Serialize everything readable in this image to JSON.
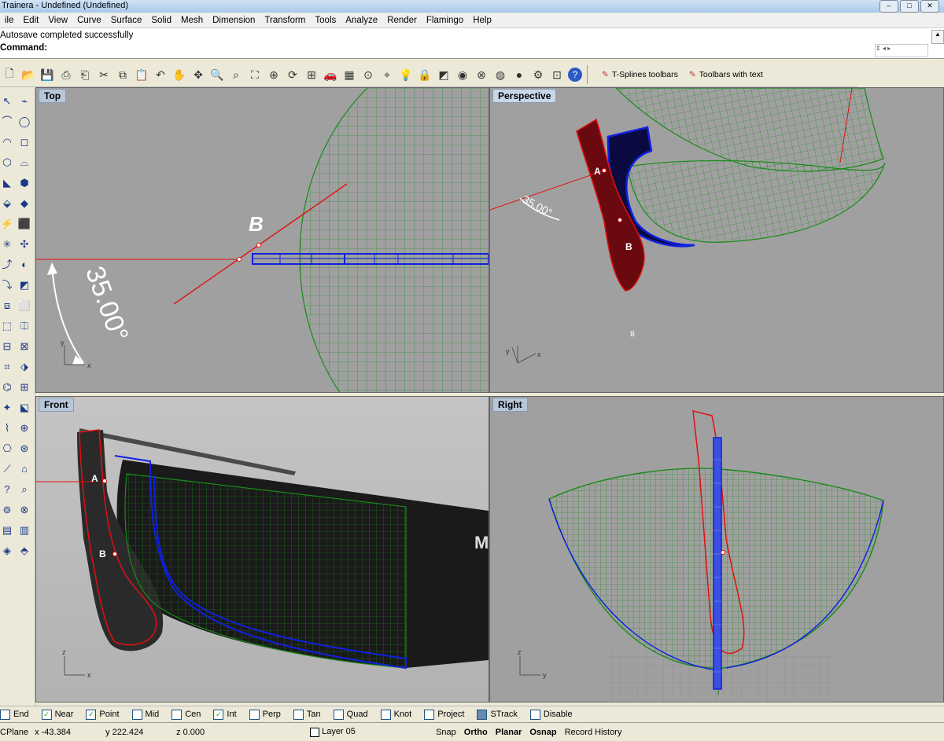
{
  "window": {
    "title": "Trainera - Undefined (Undefined)"
  },
  "menu": [
    "ile",
    "Edit",
    "View",
    "Curve",
    "Surface",
    "Solid",
    "Mesh",
    "Dimension",
    "Transform",
    "Tools",
    "Analyze",
    "Render",
    "Flamingo",
    "Help"
  ],
  "command": {
    "history": "Autosave completed successfully",
    "prompt": "Command:"
  },
  "toolbar": {
    "icons": [
      "new-file-icon",
      "open-folder-icon",
      "save-icon",
      "print-icon",
      "import-icon",
      "cut-icon",
      "copy-icon",
      "paste-icon",
      "undo-icon",
      "pan-icon",
      "rotate-view-icon",
      "zoom-icon",
      "zoom-window-icon",
      "zoom-extents-icon",
      "zoom-selected-icon",
      "rotate-icon",
      "four-viewports-icon",
      "car-icon",
      "grid-icon",
      "cplane-icon",
      "osnap-icon",
      "light-bulb-icon",
      "lock-icon",
      "shade-icon",
      "color-wheel-icon",
      "sphere-wire-icon",
      "sphere-render-icon",
      "sphere-blue-icon",
      "gear-icon",
      "group-icon",
      "help-icon"
    ],
    "tsplines_label": "T-Splines toolbars",
    "toolbars_label": "Toolbars with text"
  },
  "viewports": {
    "top": {
      "label": "Top",
      "dimension": "35.00°",
      "point_label": "B"
    },
    "perspective": {
      "label": "Perspective",
      "dimension": "35.00°",
      "point_a": "A",
      "point_b": "B",
      "small_b": "B"
    },
    "front": {
      "label": "Front",
      "point_a": "A",
      "point_b": "B",
      "boat_text": "M"
    },
    "right": {
      "label": "Right"
    }
  },
  "axes": {
    "x": "x",
    "y": "y",
    "z": "z"
  },
  "osnap": [
    {
      "label": "End",
      "checked": false
    },
    {
      "label": "Near",
      "checked": true
    },
    {
      "label": "Point",
      "checked": true
    },
    {
      "label": "Mid",
      "checked": false
    },
    {
      "label": "Cen",
      "checked": false
    },
    {
      "label": "Int",
      "checked": true
    },
    {
      "label": "Perp",
      "checked": false
    },
    {
      "label": "Tan",
      "checked": false
    },
    {
      "label": "Quad",
      "checked": false
    },
    {
      "label": "Knot",
      "checked": false
    },
    {
      "label": "Project",
      "checked": false
    },
    {
      "label": "STrack",
      "checked": true
    },
    {
      "label": "Disable",
      "checked": false
    }
  ],
  "status": {
    "cplane": "CPlane",
    "x": "x -43.384",
    "y": "y 222.424",
    "z": "z 0.000",
    "layer": "Layer 05",
    "snap": "Snap",
    "ortho": "Ortho",
    "planar": "Planar",
    "osnap": "Osnap",
    "record": "Record History"
  },
  "colors": {
    "hull": "#1a8a1a",
    "curve": "#e01010",
    "blue": "#1020e0",
    "viewport": "#a0a0a0"
  }
}
